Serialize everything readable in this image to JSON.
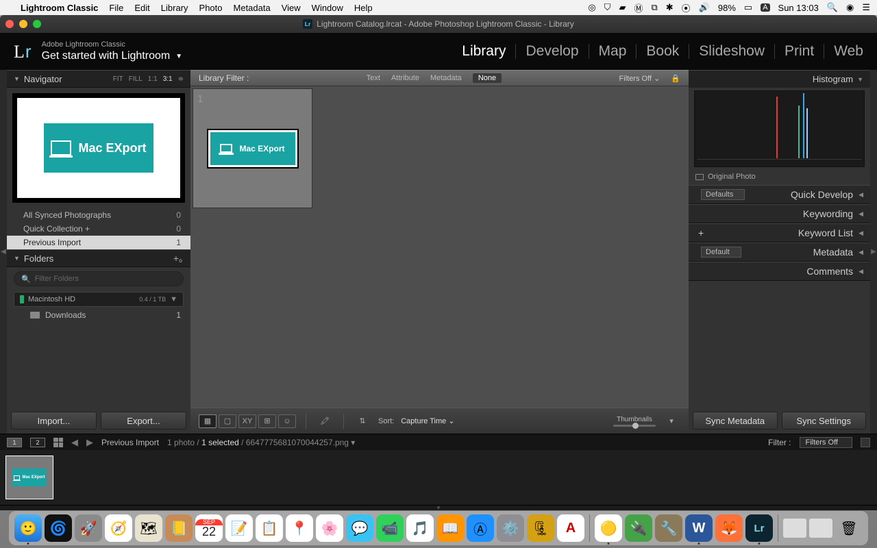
{
  "macbar": {
    "app": "Lightroom Classic",
    "menus": [
      "File",
      "Edit",
      "Library",
      "Photo",
      "Metadata",
      "View",
      "Window",
      "Help"
    ],
    "battery": "98%",
    "clock": "Sun 13:03"
  },
  "window": {
    "title": "Lightroom Catalog.lrcat - Adobe Photoshop Lightroom Classic - Library",
    "tagline": "Adobe Lightroom Classic",
    "getstarted": "Get started with Lightroom"
  },
  "modules": [
    "Library",
    "Develop",
    "Map",
    "Book",
    "Slideshow",
    "Print",
    "Web"
  ],
  "active_module": "Library",
  "navigator": {
    "title": "Navigator",
    "zoom": [
      "FIT",
      "FILL",
      "1:1",
      "3:1"
    ],
    "image_label": "Mac EXport"
  },
  "catalog": {
    "items": [
      {
        "label": "All Synced Photographs",
        "count": "0"
      },
      {
        "label": "Quick Collection  +",
        "count": "0"
      },
      {
        "label": "Previous Import",
        "count": "1",
        "active": true
      }
    ]
  },
  "folders": {
    "title": "Folders",
    "filter_placeholder": "Filter Folders",
    "drive": "Macintosh HD",
    "drive_usage": "0.4 / 1 TB",
    "items": [
      {
        "label": "Downloads",
        "count": "1"
      }
    ]
  },
  "left_buttons": {
    "import": "Import...",
    "export": "Export..."
  },
  "libfilter": {
    "label": "Library Filter :",
    "tabs": [
      "Text",
      "Attribute",
      "Metadata",
      "None"
    ],
    "active": "None",
    "filters_off": "Filters Off"
  },
  "toolbar": {
    "sort_label": "Sort:",
    "sort_value": "Capture Time",
    "thumbnails": "Thumbnails"
  },
  "rightpanel": {
    "histogram": "Histogram",
    "original": "Original Photo",
    "defaults": "Defaults",
    "sections": [
      "Quick Develop",
      "Keywording",
      "Keyword List",
      "Metadata",
      "Comments"
    ],
    "meta_dd": "Default",
    "sync_meta": "Sync Metadata",
    "sync_settings": "Sync Settings"
  },
  "stripbar": {
    "source": "Previous Import",
    "count": "1 photo /",
    "selected": "1 selected",
    "filename": "/ 6647775681070044257.png",
    "filter_label": "Filter :",
    "filter_value": "Filters Off"
  }
}
